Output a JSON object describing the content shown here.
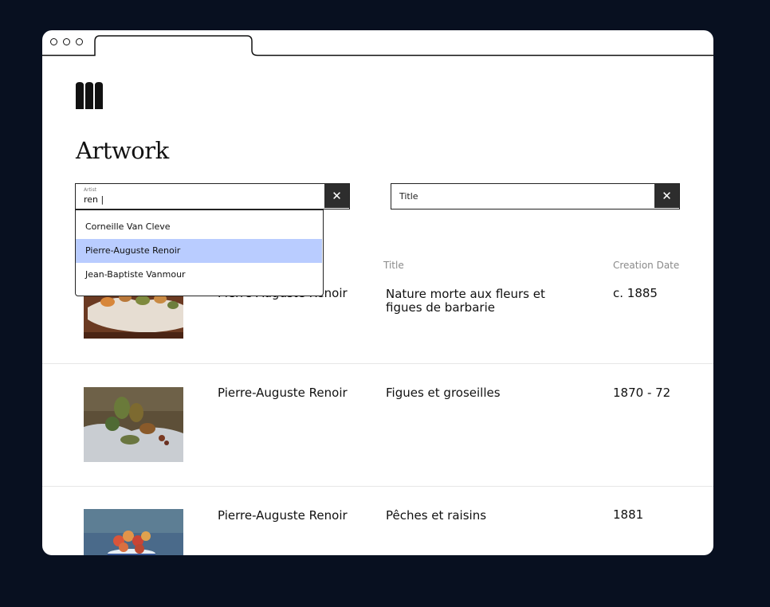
{
  "page": {
    "title": "Artwork"
  },
  "filters": {
    "artist": {
      "label": "Artist",
      "value": "ren |",
      "clear_icon": "✕"
    },
    "title": {
      "placeholder": "Title",
      "clear_icon": "✕"
    }
  },
  "dropdown": {
    "items": [
      "Corneille Van Cleve",
      "Pierre-Auguste Renoir",
      "Jean-Baptiste Vanmour"
    ],
    "selected_index": 1
  },
  "table": {
    "columns": [
      "Title",
      "Creation Date"
    ],
    "rows": [
      {
        "artist": "Pierre-Auguste Renoir",
        "title": "Nature morte aux fleurs et figues de barbarie",
        "date": "c. 1885"
      },
      {
        "artist": "Pierre-Auguste Renoir",
        "title": "Figues et groseilles",
        "date": "1870 - 72"
      },
      {
        "artist": "Pierre-Auguste Renoir",
        "title": "Pêches et raisins",
        "date": "1881"
      }
    ]
  },
  "colors": {
    "background": "#081020",
    "highlight": "#b9ccff",
    "clear_button": "#2d2d2d"
  }
}
